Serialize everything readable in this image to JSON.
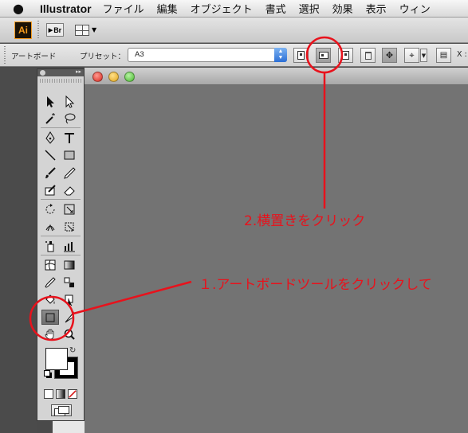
{
  "menubar": {
    "apple": "",
    "app_name": "Illustrator",
    "items": [
      "ファイル",
      "編集",
      "オブジェクト",
      "書式",
      "選択",
      "効果",
      "表示",
      "ウィン"
    ]
  },
  "appbar": {
    "logo": "Ai",
    "bridge": "Br"
  },
  "controlbar": {
    "label_artboard": "アートボード",
    "label_preset": "プリセット：",
    "preset_value": "A3",
    "x_label": "X :",
    "buttons": [
      "portrait-orientation",
      "landscape-orientation",
      "new-artboard",
      "delete-artboard",
      "move-with-artboard",
      "reference-point",
      "artboard-options"
    ]
  },
  "annotations": {
    "step2": "2.横置きをクリック",
    "step1": "１.アートボードツールをクリックして"
  },
  "colors": {
    "annotation": "#e8121c",
    "canvas": "#737373",
    "ai_orange": "#f39a1e"
  }
}
